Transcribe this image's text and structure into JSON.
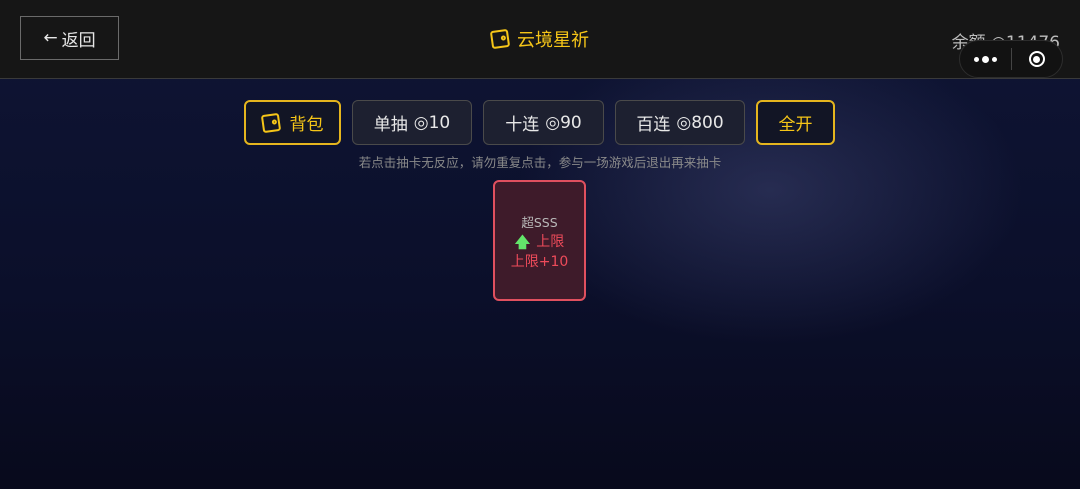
{
  "header": {
    "back_label": "返回",
    "back_icon": "arrow-left-icon",
    "title": "云境星祈",
    "title_icon": "bag-icon",
    "balance_label": "余额",
    "balance_value": "◎11476",
    "accent_color": "#f5c518"
  },
  "toolbar": {
    "bag_label": "背包",
    "single_label": "单抽",
    "single_cost": "◎10",
    "ten_label": "十连",
    "ten_cost": "◎90",
    "hundred_label": "百连",
    "hundred_cost": "◎800",
    "open_all_label": "全开"
  },
  "hint": "若点击抽卡无反应，请勿重复点击，参与一场游戏后退出再来抽卡",
  "cards": [
    {
      "rarity": "超SSS",
      "arrow": "🡅",
      "arrow_icon": "up-arrow-icon",
      "limit_label": "上限",
      "bonus": "上限+10",
      "border_color": "#e0505f"
    }
  ]
}
